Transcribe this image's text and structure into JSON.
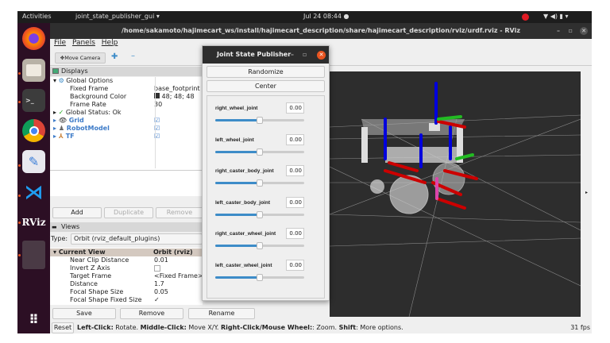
{
  "topbar": {
    "activities": "Activities",
    "app": "joint_state_publisher_gui ▾",
    "clock": "Jul 24  08:44  ●"
  },
  "dock": {
    "items": [
      "firefox",
      "files",
      "terminal",
      "chrome",
      "text-editor",
      "vscode",
      "rviz",
      "blank",
      "show-apps"
    ],
    "rviz_label": "RViz"
  },
  "window": {
    "title": "/home/sakamoto/hajimecart_ws/install/hajimecart_description/share/hajimecart_description/rviz/urdf.rviz - RViz"
  },
  "menu": {
    "file": "File",
    "panels": "Panels",
    "help": "Help"
  },
  "toolbar": {
    "move_camera": "Move Camera"
  },
  "displays": {
    "header": "Displays",
    "global_options": "Global Options",
    "rows": [
      {
        "label": "Fixed Frame",
        "value": "base_footprint"
      },
      {
        "label": "Background Color",
        "value": "48; 48; 48"
      },
      {
        "label": "Frame Rate",
        "value": "30"
      }
    ],
    "global_status": "Global Status: Ok",
    "items": [
      "Grid",
      "RobotModel",
      "TF"
    ],
    "add": "Add",
    "duplicate": "Duplicate",
    "remove": "Remove"
  },
  "views": {
    "header": "Views",
    "type_label": "Type:",
    "type_value": "Orbit (rviz_default_plugins)",
    "current_view": "Current View",
    "current_view_value": "Orbit (rviz)",
    "rows": [
      {
        "label": "Near Clip Distance",
        "value": "0.01"
      },
      {
        "label": "Invert Z Axis",
        "value": ""
      },
      {
        "label": "Target Frame",
        "value": "<Fixed Frame>"
      },
      {
        "label": "Distance",
        "value": "1.7"
      },
      {
        "label": "Focal Shape Size",
        "value": "0.05"
      },
      {
        "label": "Focal Shape Fixed Size",
        "value": "✓"
      }
    ],
    "save": "Save",
    "remove": "Remove",
    "rename": "Rename"
  },
  "status": {
    "reset": "Reset",
    "b1": "Left-Click:",
    "t1": " Rotate. ",
    "b2": "Middle-Click:",
    "t2": " Move X/Y. ",
    "b3": "Right-Click/Mouse Wheel:",
    "t3": ": Zoom. ",
    "b4": "Shift",
    "t4": ": More options.",
    "fps": "31 fps"
  },
  "jsp": {
    "title": "Joint State Publisher",
    "randomize": "Randomize",
    "center": "Center",
    "joints": [
      {
        "name": "right_wheel_joint",
        "value": "0.00",
        "slider": 0.5
      },
      {
        "name": "left_wheel_joint",
        "value": "0.00",
        "slider": 0.5
      },
      {
        "name": "right_caster_body_joint",
        "value": "0.00",
        "slider": 0.5
      },
      {
        "name": "left_caster_body_joint",
        "value": "0.00",
        "slider": 0.5
      },
      {
        "name": "right_caster_wheel_joint",
        "value": "0.00",
        "slider": 0.5
      },
      {
        "name": "left_caster_wheel_joint",
        "value": "0.00",
        "slider": 0.5
      }
    ]
  },
  "colors": {
    "viewport_bg": "#303030",
    "accent": "#3d8cc8",
    "ubuntu_orange": "#e95420"
  }
}
